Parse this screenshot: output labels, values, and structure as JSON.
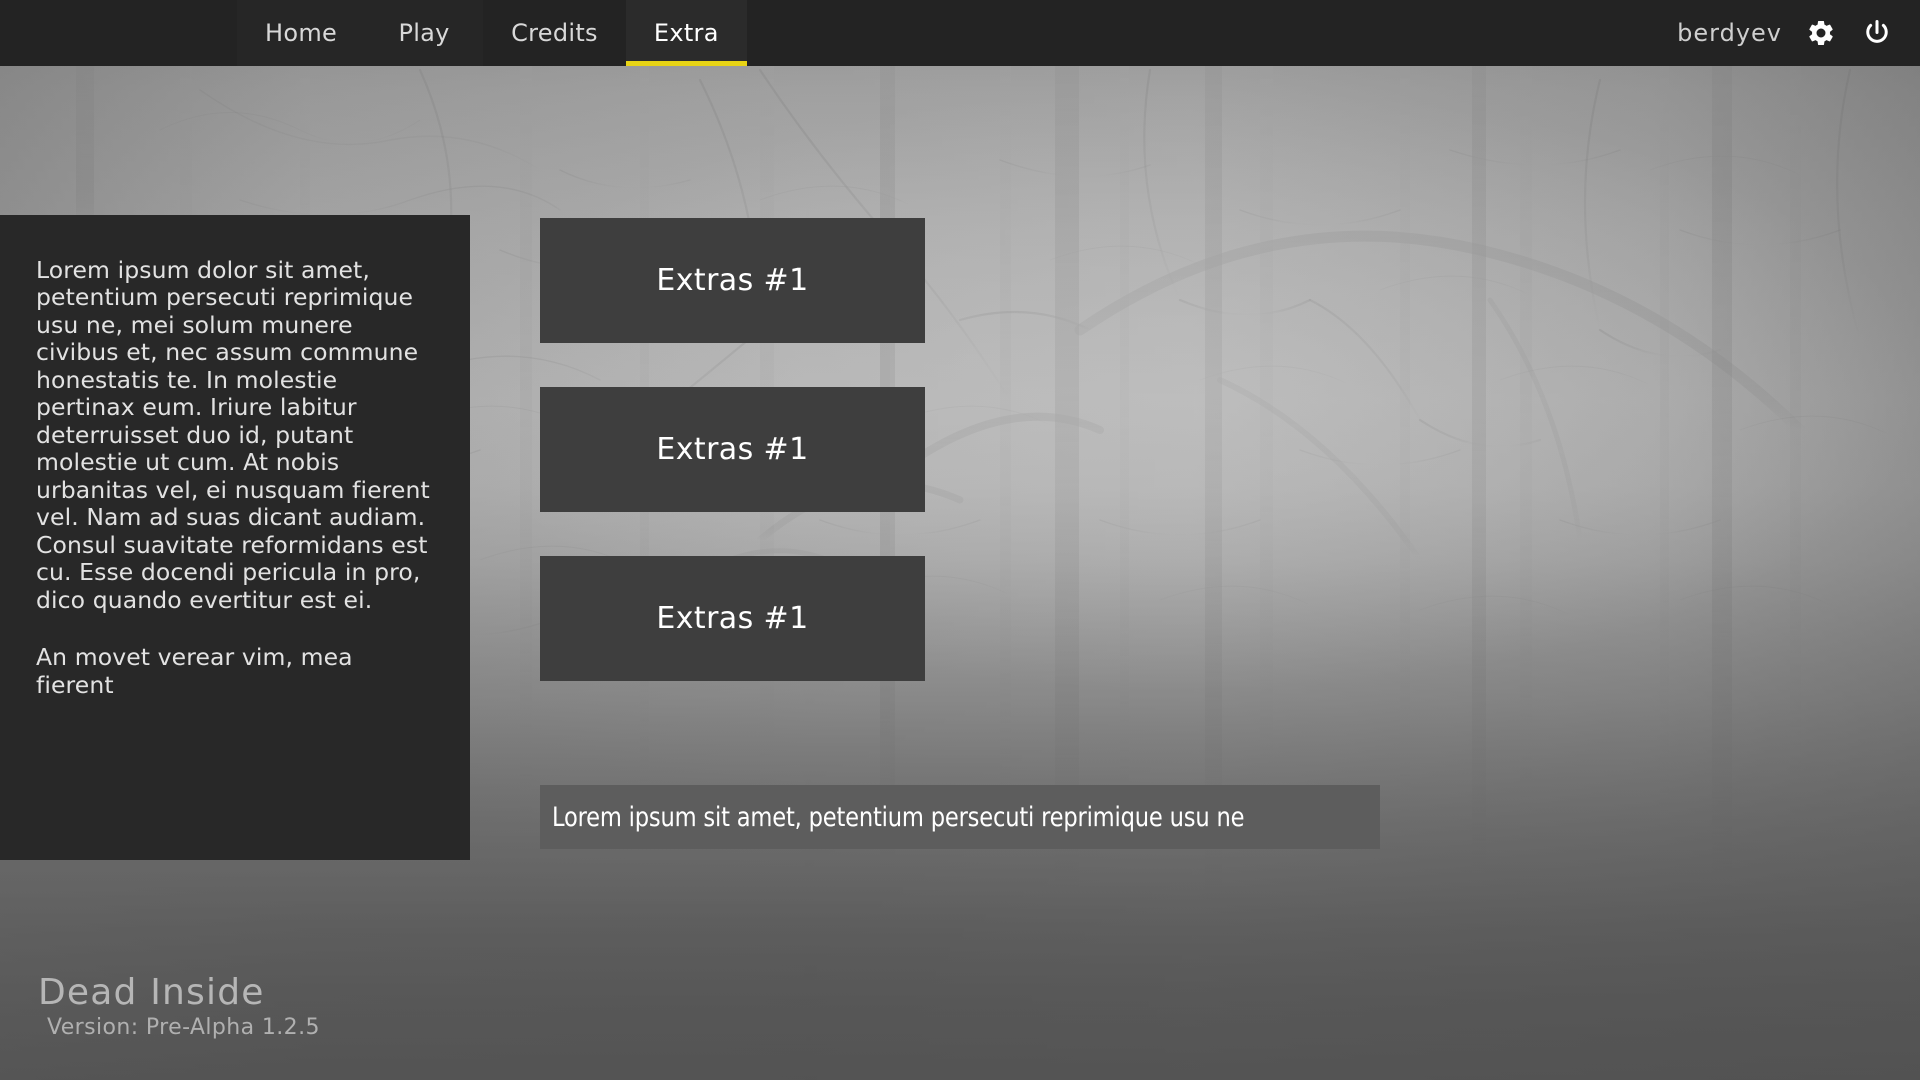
{
  "app": {
    "title": "Dead Inside",
    "version_label": "Version: Pre-Alpha 1.2.5"
  },
  "header": {
    "tabs": [
      {
        "label": "Home",
        "active": false
      },
      {
        "label": "Play",
        "active": false
      },
      {
        "label": "Credits",
        "active": false
      },
      {
        "label": "Extra",
        "active": true
      }
    ],
    "username": "berdyev",
    "settings_icon": "gear-icon",
    "power_icon": "power-icon",
    "bar_color": "#232323",
    "active_underline_color": "#e8d415"
  },
  "sidebar": {
    "paragraph_1": "Lorem ipsum dolor sit amet, petentium persecuti reprimique usu ne, mei solum munere civibus et, nec assum commune honestatis te. In molestie pertinax eum. Iriure labitur deterruisset duo id, putant molestie ut cum. At nobis urbanitas vel, ei nusquam fierent vel. Nam ad suas dicant audiam. Consul suavitate reformidans est cu. Esse docendi pericula in pro, dico quando evertitur est ei.",
    "paragraph_2": "An movet verear vim, mea fierent",
    "background_color": "#282828"
  },
  "main": {
    "extras": [
      {
        "label": "Extras #1"
      },
      {
        "label": "Extras #1"
      },
      {
        "label": "Extras #1"
      }
    ],
    "banner_text": "Lorem ipsum sit amet, petentium persecuti reprimique usu ne",
    "button_color": "#3e3e3e",
    "banner_color": "#5d5d5d"
  }
}
